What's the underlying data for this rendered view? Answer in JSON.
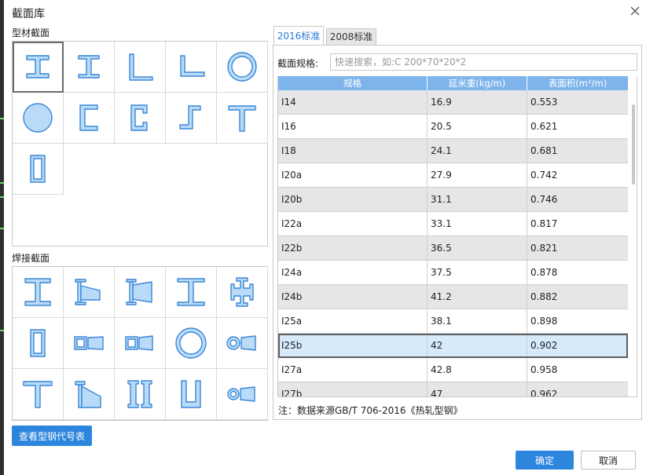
{
  "window": {
    "title": "截面库"
  },
  "sections": {
    "profile_label": "型材截面",
    "welded_label": "焊接截面"
  },
  "profile_shapes": [
    {
      "icon": "i-beam-icon",
      "selected": true
    },
    {
      "icon": "i-beam-narrow-icon"
    },
    {
      "icon": "angle-equal-icon"
    },
    {
      "icon": "angle-unequal-icon"
    },
    {
      "icon": "circular-tube-icon"
    },
    {
      "icon": "round-bar-icon"
    },
    {
      "icon": "channel-icon"
    },
    {
      "icon": "lipped-channel-icon"
    },
    {
      "icon": "z-section-icon"
    },
    {
      "icon": "t-section-icon"
    },
    {
      "icon": "rectangular-tube-icon"
    }
  ],
  "welded_shapes": [
    {
      "icon": "welded-i-beam-icon"
    },
    {
      "icon": "tapered-i-beam-icon"
    },
    {
      "icon": "tapered-i-beam-both-icon"
    },
    {
      "icon": "welded-i-beam-wide-icon"
    },
    {
      "icon": "cross-section-icon"
    },
    {
      "icon": "welded-box-icon"
    },
    {
      "icon": "tapered-box-icon"
    },
    {
      "icon": "tapered-box-short-icon"
    },
    {
      "icon": "welded-circular-tube-icon"
    },
    {
      "icon": "tapered-tube-icon"
    },
    {
      "icon": "welded-t-section-icon"
    },
    {
      "icon": "tapered-t-section-icon"
    },
    {
      "icon": "double-channel-icon"
    },
    {
      "icon": "u-section-icon"
    },
    {
      "icon": "tapered-tube-small-icon"
    }
  ],
  "tabs": [
    {
      "label": "2016标准",
      "active": true
    },
    {
      "label": "2008标准",
      "active": false
    }
  ],
  "search": {
    "label": "截面规格:",
    "placeholder": "快速搜索，如:C 200*70*20*2"
  },
  "table": {
    "headers": [
      "规格",
      "延米重(kg/m)",
      "表面积(m²/m)"
    ],
    "rows": [
      {
        "spec": "I14",
        "weight": "16.9",
        "area": "0.553"
      },
      {
        "spec": "I16",
        "weight": "20.5",
        "area": "0.621"
      },
      {
        "spec": "I18",
        "weight": "24.1",
        "area": "0.681"
      },
      {
        "spec": "I20a",
        "weight": "27.9",
        "area": "0.742"
      },
      {
        "spec": "I20b",
        "weight": "31.1",
        "area": "0.746"
      },
      {
        "spec": "I22a",
        "weight": "33.1",
        "area": "0.817"
      },
      {
        "spec": "I22b",
        "weight": "36.5",
        "area": "0.821"
      },
      {
        "spec": "I24a",
        "weight": "37.5",
        "area": "0.878"
      },
      {
        "spec": "I24b",
        "weight": "41.2",
        "area": "0.882"
      },
      {
        "spec": "I25a",
        "weight": "38.1",
        "area": "0.898"
      },
      {
        "spec": "I25b",
        "weight": "42",
        "area": "0.902",
        "selected": true
      },
      {
        "spec": "I27a",
        "weight": "42.8",
        "area": "0.958"
      },
      {
        "spec": "I27b",
        "weight": "47",
        "area": "0.962"
      }
    ]
  },
  "note": "注：数据来源GB/T 706-2016《热轧型钢》",
  "buttons": {
    "view_codes": "查看型钢代号表",
    "ok": "确定",
    "cancel": "取消"
  },
  "colors": {
    "accent": "#2d86dd",
    "header": "#7eb4ec",
    "icon_fill": "#b9dbf7",
    "icon_stroke": "#3b86d6",
    "selected_row": "#d6eafc"
  }
}
